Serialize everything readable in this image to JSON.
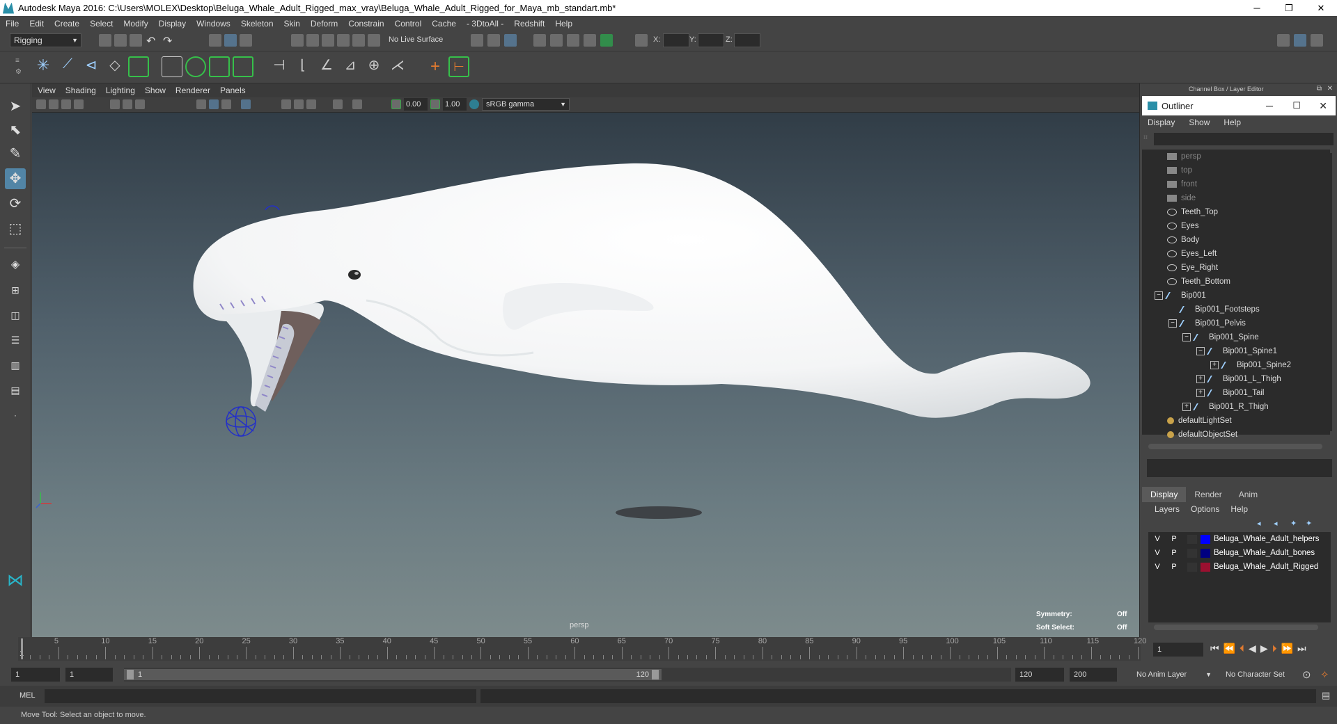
{
  "window": {
    "title": "Autodesk Maya 2016: C:\\Users\\MOLEX\\Desktop\\Beluga_Whale_Adult_Rigged_max_vray\\Beluga_Whale_Adult_Rigged_for_Maya_mb_standart.mb*",
    "minimize": "─",
    "restore": "❐",
    "close": "✕"
  },
  "menubar": [
    "File",
    "Edit",
    "Create",
    "Select",
    "Modify",
    "Display",
    "Windows",
    "Skeleton",
    "Skin",
    "Deform",
    "Constrain",
    "Control",
    "Cache",
    "- 3DtoAll -",
    "Redshift",
    "Help"
  ],
  "statusline": {
    "mode": "Rigging",
    "live_surface": "No Live Surface",
    "x_label": "X:",
    "y_label": "Y:",
    "z_label": "Z:"
  },
  "viewport": {
    "menus": [
      "View",
      "Shading",
      "Lighting",
      "Show",
      "Renderer",
      "Panels"
    ],
    "exposure": "0.00",
    "gamma": "1.00",
    "color_space": "sRGB gamma",
    "camera_label": "persp",
    "symmetry_label": "Symmetry:",
    "symmetry_value": "Off",
    "soft_select_label": "Soft Select:",
    "soft_select_value": "Off"
  },
  "channel_box_title": "Channel Box / Layer Editor",
  "outliner": {
    "title": "Outliner",
    "menus": [
      "Display",
      "Show",
      "Help"
    ],
    "items": [
      {
        "label": "persp",
        "dim": true
      },
      {
        "label": "top",
        "dim": true
      },
      {
        "label": "front",
        "dim": true
      },
      {
        "label": "side",
        "dim": true
      },
      {
        "label": "Teeth_Top"
      },
      {
        "label": "Eyes"
      },
      {
        "label": "Body"
      },
      {
        "label": "Eyes_Left"
      },
      {
        "label": "Eye_Right"
      },
      {
        "label": "Teeth_Bottom"
      },
      {
        "label": "Bip001"
      },
      {
        "label": "Bip001_Footsteps"
      },
      {
        "label": "Bip001_Pelvis"
      },
      {
        "label": "Bip001_Spine"
      },
      {
        "label": "Bip001_Spine1"
      },
      {
        "label": "Bip001_Spine2"
      },
      {
        "label": "Bip001_L_Thigh"
      },
      {
        "label": "Bip001_Tail"
      },
      {
        "label": "Bip001_R_Thigh"
      },
      {
        "label": "defaultLightSet"
      },
      {
        "label": "defaultObjectSet"
      }
    ]
  },
  "layer_editor": {
    "tabs": [
      "Display",
      "Render",
      "Anim"
    ],
    "menus": [
      "Layers",
      "Options",
      "Help"
    ],
    "layers": [
      {
        "v": "V",
        "p": "P",
        "name": "Beluga_Whale_Adult_helpers",
        "color": "#0000ff"
      },
      {
        "v": "V",
        "p": "P",
        "name": "Beluga_Whale_Adult_bones",
        "color": "#000080"
      },
      {
        "v": "V",
        "p": "P",
        "name": "Beluga_Whale_Adult_Rigged",
        "color": "#9b1030"
      }
    ]
  },
  "timeline": {
    "ticks": [
      "5",
      "10",
      "15",
      "20",
      "25",
      "30",
      "35",
      "40",
      "45",
      "50",
      "55",
      "60",
      "65",
      "70",
      "75",
      "80",
      "85",
      "90",
      "95",
      "100",
      "105",
      "110",
      "115",
      "120"
    ],
    "start_label": "1",
    "current_frame": "1"
  },
  "range": {
    "start": "1",
    "anim_start": "1",
    "range_start": "1",
    "range_end": "120",
    "end": "120",
    "anim_end": "200",
    "anim_layer": "No Anim Layer",
    "char_set": "No Character Set"
  },
  "cmdline": {
    "label": "MEL"
  },
  "helpline": {
    "text": "Move Tool: Select an object to move."
  }
}
